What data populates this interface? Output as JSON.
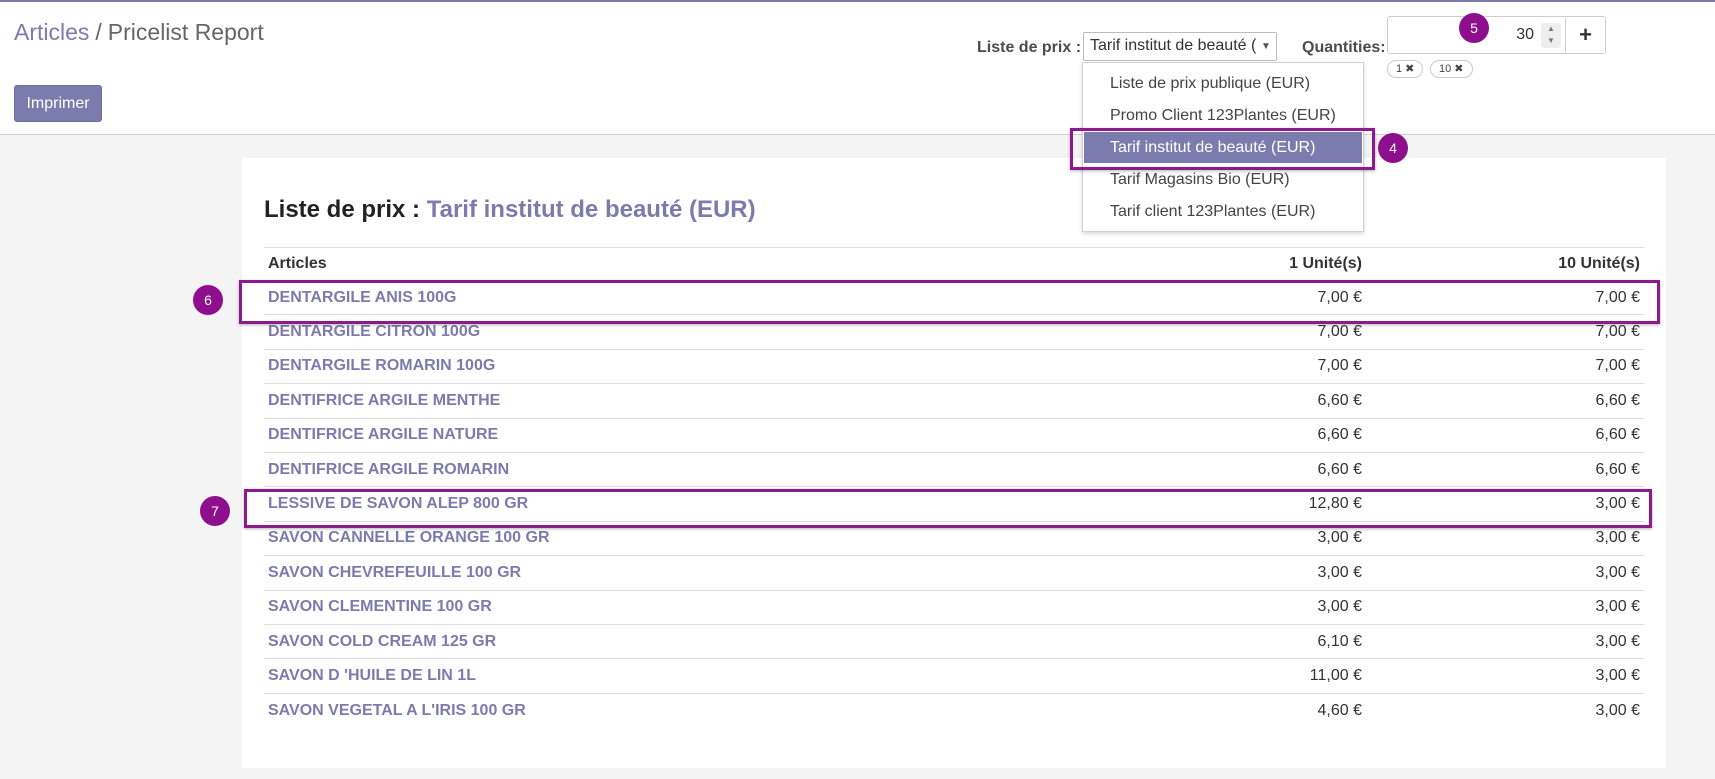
{
  "breadcrumb": {
    "parent": "Articles",
    "separator": "/",
    "current": "Pricelist Report"
  },
  "toolbar": {
    "print_label": "Imprimer"
  },
  "filters": {
    "pricelist_label": "Liste de prix :",
    "pricelist_value": "Tarif institut de beauté (",
    "pricelist_options": [
      "Liste de prix publique (EUR)",
      "Promo Client 123Plantes (EUR)",
      "Tarif institut de beauté (EUR)",
      "Tarif Magasins Bio (EUR)",
      "Tarif client 123Plantes (EUR)"
    ],
    "selected_option_index": 2,
    "quantities_label": "Quantities:",
    "quantity_value": "30",
    "quantity_tags": [
      "1 ✖",
      "10 ✖"
    ]
  },
  "report": {
    "title_prefix": "Liste de prix :",
    "title_pricelist": "Tarif institut de beauté (EUR)",
    "columns": [
      "Articles",
      "1 Unité(s)",
      "10 Unité(s)"
    ],
    "rows": [
      {
        "name": "DENTARGILE ANIS 100G",
        "q1": "7,00 €",
        "q10": "7,00 €"
      },
      {
        "name": "DENTARGILE CITRON 100G",
        "q1": "7,00 €",
        "q10": "7,00 €"
      },
      {
        "name": "DENTARGILE ROMARIN 100G",
        "q1": "7,00 €",
        "q10": "7,00 €"
      },
      {
        "name": "DENTIFRICE ARGILE MENTHE",
        "q1": "6,60 €",
        "q10": "6,60 €"
      },
      {
        "name": "DENTIFRICE ARGILE NATURE",
        "q1": "6,60 €",
        "q10": "6,60 €"
      },
      {
        "name": "DENTIFRICE ARGILE ROMARIN",
        "q1": "6,60 €",
        "q10": "6,60 €"
      },
      {
        "name": "LESSIVE DE SAVON ALEP 800 GR",
        "q1": "12,80 €",
        "q10": "3,00 €"
      },
      {
        "name": "SAVON CANNELLE ORANGE 100 GR",
        "q1": "3,00 €",
        "q10": "3,00 €"
      },
      {
        "name": "SAVON CHEVREFEUILLE 100 GR",
        "q1": "3,00 €",
        "q10": "3,00 €"
      },
      {
        "name": "SAVON CLEMENTINE 100 GR",
        "q1": "3,00 €",
        "q10": "3,00 €"
      },
      {
        "name": "SAVON COLD CREAM 125 GR",
        "q1": "6,10 €",
        "q10": "3,00 €"
      },
      {
        "name": "SAVON D 'HUILE DE LIN 1L",
        "q1": "11,00 €",
        "q10": "3,00 €"
      },
      {
        "name": "SAVON VEGETAL A L'IRIS 100 GR",
        "q1": "4,60 €",
        "q10": "3,00 €"
      }
    ]
  },
  "annotations": {
    "markers": [
      "4",
      "5",
      "6",
      "7"
    ]
  },
  "colors": {
    "accent": "#7c7bad",
    "annotation": "#8e0f8e"
  },
  "icons": {
    "caret": "caret-down-icon",
    "plus": "plus-icon",
    "spin": "spinner-icon"
  }
}
